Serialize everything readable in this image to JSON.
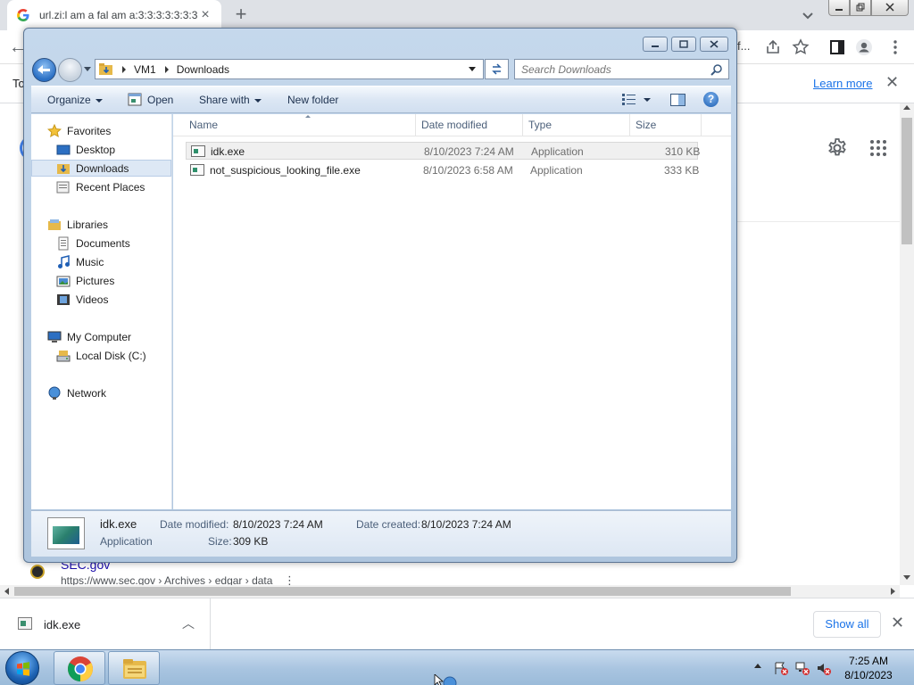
{
  "browser": {
    "tab_title": "url.zi:l am a fal am a:3:3:3:3:3:3:3",
    "url_tail": "f...",
    "infobar_text": "To",
    "learn_more": "Learn more"
  },
  "search_result": {
    "title": "SEC.gov",
    "url": "https://www.sec.gov › Archives › edgar › data"
  },
  "download_shelf": {
    "file_name": "idk.exe",
    "show_all": "Show all"
  },
  "explorer": {
    "breadcrumb": [
      "VM1",
      "Downloads"
    ],
    "search_placeholder": "Search Downloads",
    "commands": {
      "organize": "Organize",
      "open": "Open",
      "share_with": "Share with",
      "new_folder": "New folder"
    },
    "nav": {
      "favorites": "Favorites",
      "desktop": "Desktop",
      "downloads": "Downloads",
      "recent_places": "Recent Places",
      "libraries": "Libraries",
      "documents": "Documents",
      "music": "Music",
      "pictures": "Pictures",
      "videos": "Videos",
      "my_computer": "My Computer",
      "local_disk": "Local Disk (C:)",
      "network": "Network"
    },
    "columns": {
      "name": "Name",
      "date_modified": "Date modified",
      "type": "Type",
      "size": "Size"
    },
    "files": [
      {
        "name": "idk.exe",
        "date_modified": "8/10/2023 7:24 AM",
        "type": "Application",
        "size": "310 KB",
        "selected": true
      },
      {
        "name": "not_suspicious_looking_file.exe",
        "date_modified": "8/10/2023 6:58 AM",
        "type": "Application",
        "size": "333 KB",
        "selected": false
      }
    ],
    "details": {
      "name": "idk.exe",
      "type": "Application",
      "date_modified_label": "Date modified:",
      "date_modified": "8/10/2023 7:24 AM",
      "date_created_label": "Date created:",
      "date_created": "8/10/2023 7:24 AM",
      "size_label": "Size:",
      "size": "309 KB"
    }
  },
  "taskbar": {
    "time": "7:25 AM",
    "date": "8/10/2023"
  },
  "colors": {
    "link_blue": "#1a73e8",
    "explorer_frame": "#b8cde3",
    "taskbar": "#a8c4e0"
  }
}
